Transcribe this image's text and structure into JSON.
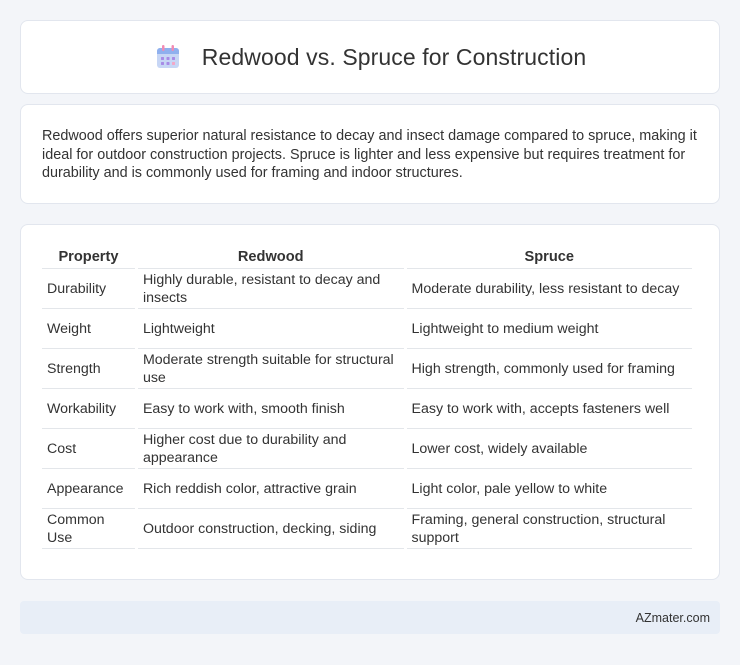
{
  "header": {
    "title": "Redwood vs. Spruce for Construction",
    "icon": "calendar-icon"
  },
  "summary": {
    "text": "Redwood offers superior natural resistance to decay and insect damage compared to spruce, making it ideal for outdoor construction projects. Spruce is lighter and less expensive but requires treatment for durability and is commonly used for framing and indoor structures."
  },
  "table": {
    "headers": [
      "Property",
      "Redwood",
      "Spruce"
    ],
    "rows": [
      [
        "Durability",
        "Highly durable, resistant to decay and insects",
        "Moderate durability, less resistant to decay"
      ],
      [
        "Weight",
        "Lightweight",
        "Lightweight to medium weight"
      ],
      [
        "Strength",
        "Moderate strength suitable for structural use",
        "High strength, commonly used for framing"
      ],
      [
        "Workability",
        "Easy to work with, smooth finish",
        "Easy to work with, accepts fasteners well"
      ],
      [
        "Cost",
        "Higher cost due to durability and appearance",
        "Lower cost, widely available"
      ],
      [
        "Appearance",
        "Rich reddish color, attractive grain",
        "Light color, pale yellow to white"
      ],
      [
        "Common Use",
        "Outdoor construction, decking, siding",
        "Framing, general construction, structural support"
      ]
    ]
  },
  "footer": {
    "site": "AZmater.com"
  },
  "colors": {
    "background": "#f3f5f9",
    "card": "#ffffff",
    "footer": "#e8eef7",
    "text": "#333333"
  }
}
